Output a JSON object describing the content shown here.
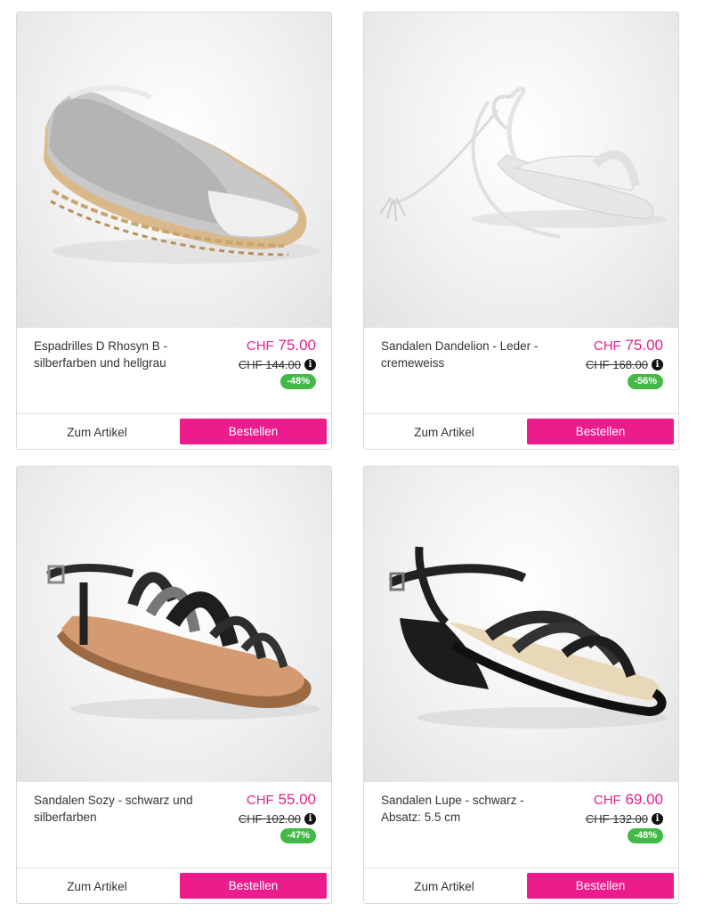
{
  "products": [
    {
      "name": "Espadrilles D Rhosyn B - silberfarben und hellgrau",
      "currency": "CHF",
      "price": "75.00",
      "old_price": "CHF 144.00",
      "discount": "-48%",
      "details_label": "Zum Artikel",
      "order_label": "Bestellen",
      "info_icon": "i"
    },
    {
      "name": "Sandalen Dandelion - Leder - cremeweiss",
      "currency": "CHF",
      "price": "75.00",
      "old_price": "CHF 168.00",
      "discount": "-56%",
      "details_label": "Zum Artikel",
      "order_label": "Bestellen",
      "info_icon": "i"
    },
    {
      "name": "Sandalen Sozy - schwarz und silberfarben",
      "currency": "CHF",
      "price": "55.00",
      "old_price": "CHF 102.00",
      "discount": "-47%",
      "details_label": "Zum Artikel",
      "order_label": "Bestellen",
      "info_icon": "i"
    },
    {
      "name": "Sandalen Lupe - schwarz - Absatz: 5.5 cm",
      "currency": "CHF",
      "price": "69.00",
      "old_price": "CHF 132.00",
      "discount": "-48%",
      "details_label": "Zum Artikel",
      "order_label": "Bestellen",
      "info_icon": "i"
    }
  ],
  "colors": {
    "price": "#e6218b",
    "order_button": "#ec1c8d",
    "discount_badge": "#43b947"
  }
}
